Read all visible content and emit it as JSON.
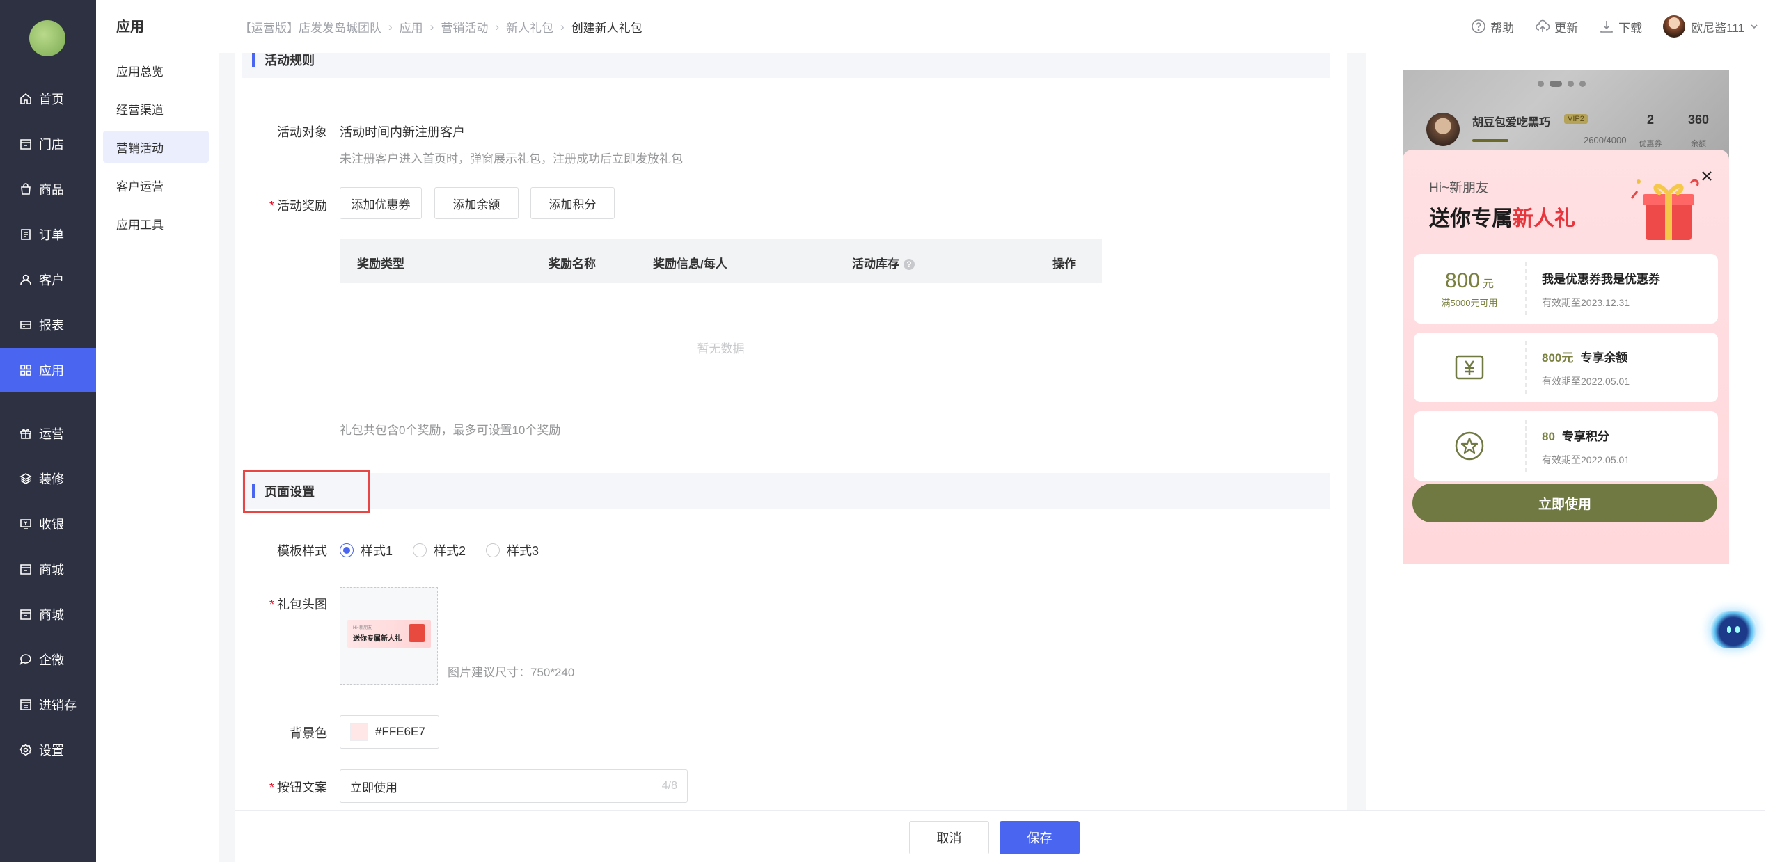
{
  "sidebar": {
    "items": [
      {
        "label": "首页",
        "icon": "home-icon"
      },
      {
        "label": "门店",
        "icon": "store-icon"
      },
      {
        "label": "商品",
        "icon": "bag-icon"
      },
      {
        "label": "订单",
        "icon": "order-icon"
      },
      {
        "label": "客户",
        "icon": "user-icon"
      },
      {
        "label": "报表",
        "icon": "report-icon"
      },
      {
        "label": "应用",
        "icon": "apps-icon",
        "active": true
      },
      {
        "label": "运营",
        "icon": "gift-icon"
      },
      {
        "label": "装修",
        "icon": "layers-icon"
      },
      {
        "label": "收银",
        "icon": "cashier-icon"
      },
      {
        "label": "商城",
        "icon": "shop-icon"
      },
      {
        "label": "商城",
        "icon": "shop-icon"
      },
      {
        "label": "企微",
        "icon": "chat-icon"
      },
      {
        "label": "进销存",
        "icon": "inventory-icon"
      },
      {
        "label": "设置",
        "icon": "settings-icon"
      }
    ]
  },
  "sub_sidebar": {
    "title": "应用",
    "items": [
      "应用总览",
      "经营渠道",
      "营销活动",
      "客户运营",
      "应用工具"
    ],
    "active_index": 2
  },
  "header": {
    "breadcrumb": [
      "【运营版】店发发岛城团队",
      "应用",
      "营销活动",
      "新人礼包",
      "创建新人礼包"
    ],
    "actions": {
      "help": "帮助",
      "update": "更新",
      "download": "下载"
    },
    "user_name": "欧尼酱111"
  },
  "form": {
    "section_rules": "活动规则",
    "target_label": "活动对象",
    "target_value": "活动时间内新注册客户",
    "target_hint": "未注册客户进入首页时，弹窗展示礼包，注册成功后立即发放礼包",
    "reward_label": "活动奖励",
    "reward_buttons": [
      "添加优惠券",
      "添加余额",
      "添加积分"
    ],
    "table_headers": [
      "奖励类型",
      "奖励名称",
      "奖励信息/每人",
      "活动库存",
      "操作"
    ],
    "table_empty": "暂无数据",
    "reward_hint": "礼包共包含0个奖励，最多可设置10个奖励",
    "section_page": "页面设置",
    "template_label": "模板样式",
    "template_options": [
      "样式1",
      "样式2",
      "样式3"
    ],
    "template_selected": 0,
    "header_img_label": "礼包头图",
    "thumb_small": "Hi~新朋友",
    "thumb_title": "送你专属新人礼",
    "img_hint": "图片建议尺寸：750*240",
    "bg_label": "背景色",
    "bg_value": "#FFE6E7",
    "btn_text_label": "按钮文案",
    "btn_text_value": "立即使用",
    "btn_text_count": "4/8"
  },
  "preview": {
    "user_name": "胡豆包爱吃黑巧",
    "vip": "VIP2",
    "progress_text": "2600/4000",
    "progress_fraction": 0.65,
    "stats": [
      {
        "value": "2",
        "label": "优惠券"
      },
      {
        "value": "360",
        "label": "余额"
      }
    ],
    "greeting": "Hi~新朋友",
    "headline_prefix": "送你专属",
    "headline_red": "新人礼",
    "coupon1": {
      "amount": "800",
      "unit": "元",
      "condition": "满5000元可用",
      "name": "我是优惠券我是优惠券",
      "expiry": "有效期至2023.12.31"
    },
    "coupon2": {
      "amount": "800元",
      "name": "专享余额",
      "expiry": "有效期至2022.05.01"
    },
    "coupon3": {
      "amount": "80",
      "name": "专享积分",
      "expiry": "有效期至2022.05.01"
    },
    "use_button": "立即使用"
  },
  "footer": {
    "cancel": "取消",
    "save": "保存"
  },
  "colors": {
    "primary": "#4a66f0",
    "sidebar_bg": "#2d3142",
    "olive": "#717943",
    "required": "#ee0a24",
    "highlight": "#e84545"
  }
}
